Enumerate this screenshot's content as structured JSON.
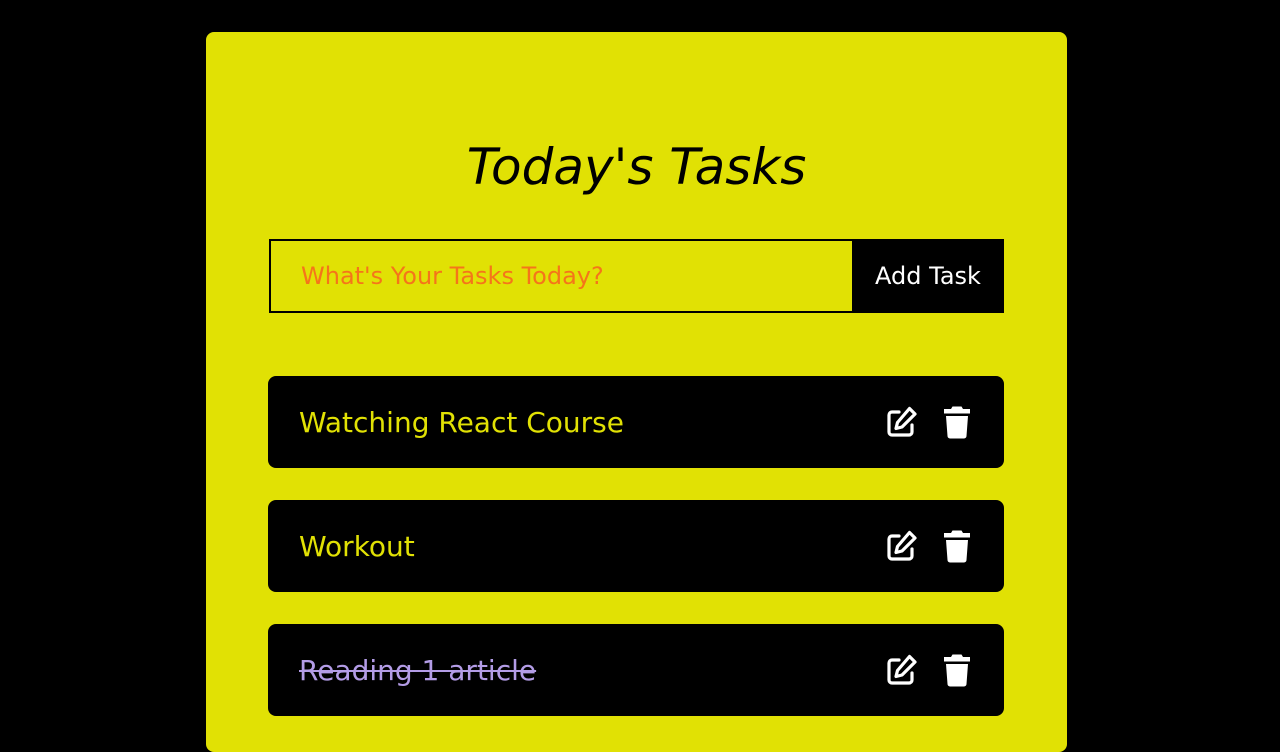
{
  "header": {
    "title": "Today's Tasks"
  },
  "form": {
    "placeholder": "What's Your Tasks Today?",
    "add_label": "Add Task"
  },
  "tasks": [
    {
      "text": "Watching React Course",
      "completed": false
    },
    {
      "text": "Workout",
      "completed": false
    },
    {
      "text": "Reading 1 article",
      "completed": true
    }
  ],
  "icons": {
    "edit": "edit-icon",
    "delete": "trash-icon"
  },
  "colors": {
    "background": "#000000",
    "card": "#e1e104",
    "placeholder": "#f5751a",
    "task_text": "#e1e104",
    "completed_text": "#b39ce6",
    "icon": "#ffffff"
  }
}
